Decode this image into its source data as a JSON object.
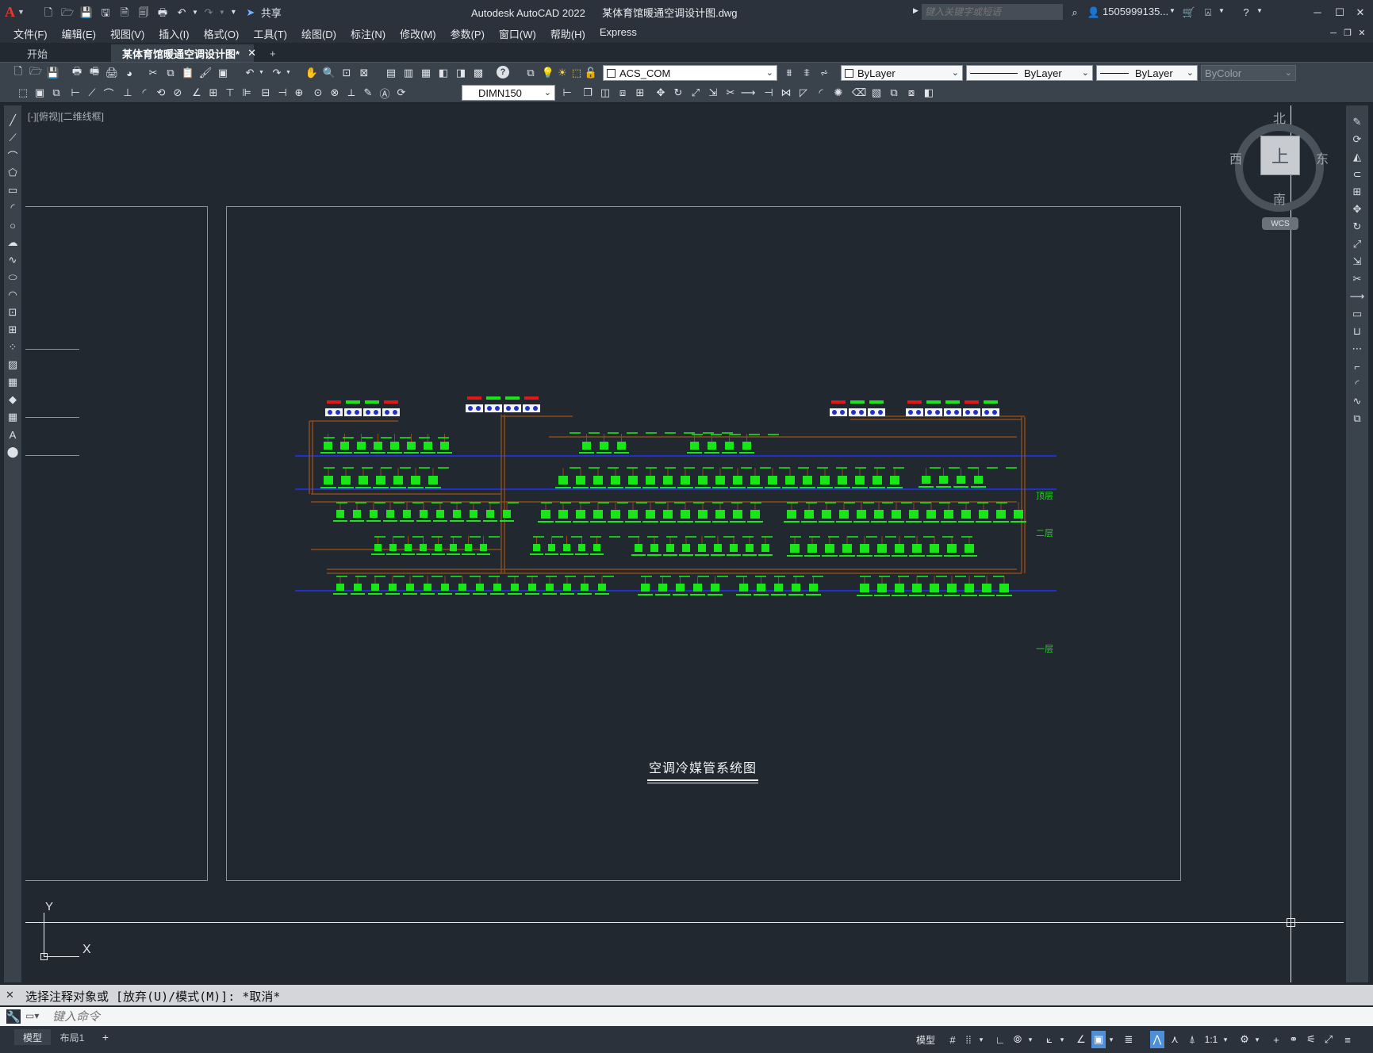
{
  "titlebar": {
    "app_title": "Autodesk AutoCAD 2022",
    "doc_title": "某体育馆暖通空调设计图.dwg",
    "share_label": "共享",
    "search_placeholder": "键入关键字或短语",
    "user_name": "1505999135..."
  },
  "menu": {
    "items": [
      "文件(F)",
      "编辑(E)",
      "视图(V)",
      "插入(I)",
      "格式(O)",
      "工具(T)",
      "绘图(D)",
      "标注(N)",
      "修改(M)",
      "参数(P)",
      "窗口(W)",
      "帮助(H)",
      "Express"
    ]
  },
  "tabs": {
    "start": "开始",
    "doc": "某体育馆暖通空调设计图*",
    "add": "+"
  },
  "toolbar": {
    "ucs_combo": "ACS_COM",
    "layer_combo": "ByLayer",
    "linetype_combo": "ByLayer",
    "lineweight_combo": "ByLayer",
    "color_combo": "ByColor",
    "dimstyle_combo": "DIMN150"
  },
  "viewport": {
    "view_label": "[-][俯视][二维线框]",
    "drawing_title": "空调冷媒管系统图",
    "floor_labels": [
      "顶层",
      "二层",
      "一层"
    ],
    "viewcube": {
      "north": "北",
      "south": "南",
      "east": "东",
      "west": "西",
      "top": "上",
      "wcs": "WCS"
    },
    "ucs": {
      "x": "X",
      "y": "Y"
    }
  },
  "command": {
    "history": "选择注释对象或 [放弃(U)/模式(M)]: *取消*",
    "input_placeholder": "键入命令"
  },
  "status": {
    "model_tab": "模型",
    "layout_tab": "布局1",
    "add_tab": "+",
    "model_label": "模型",
    "scale_label": "1:1"
  }
}
